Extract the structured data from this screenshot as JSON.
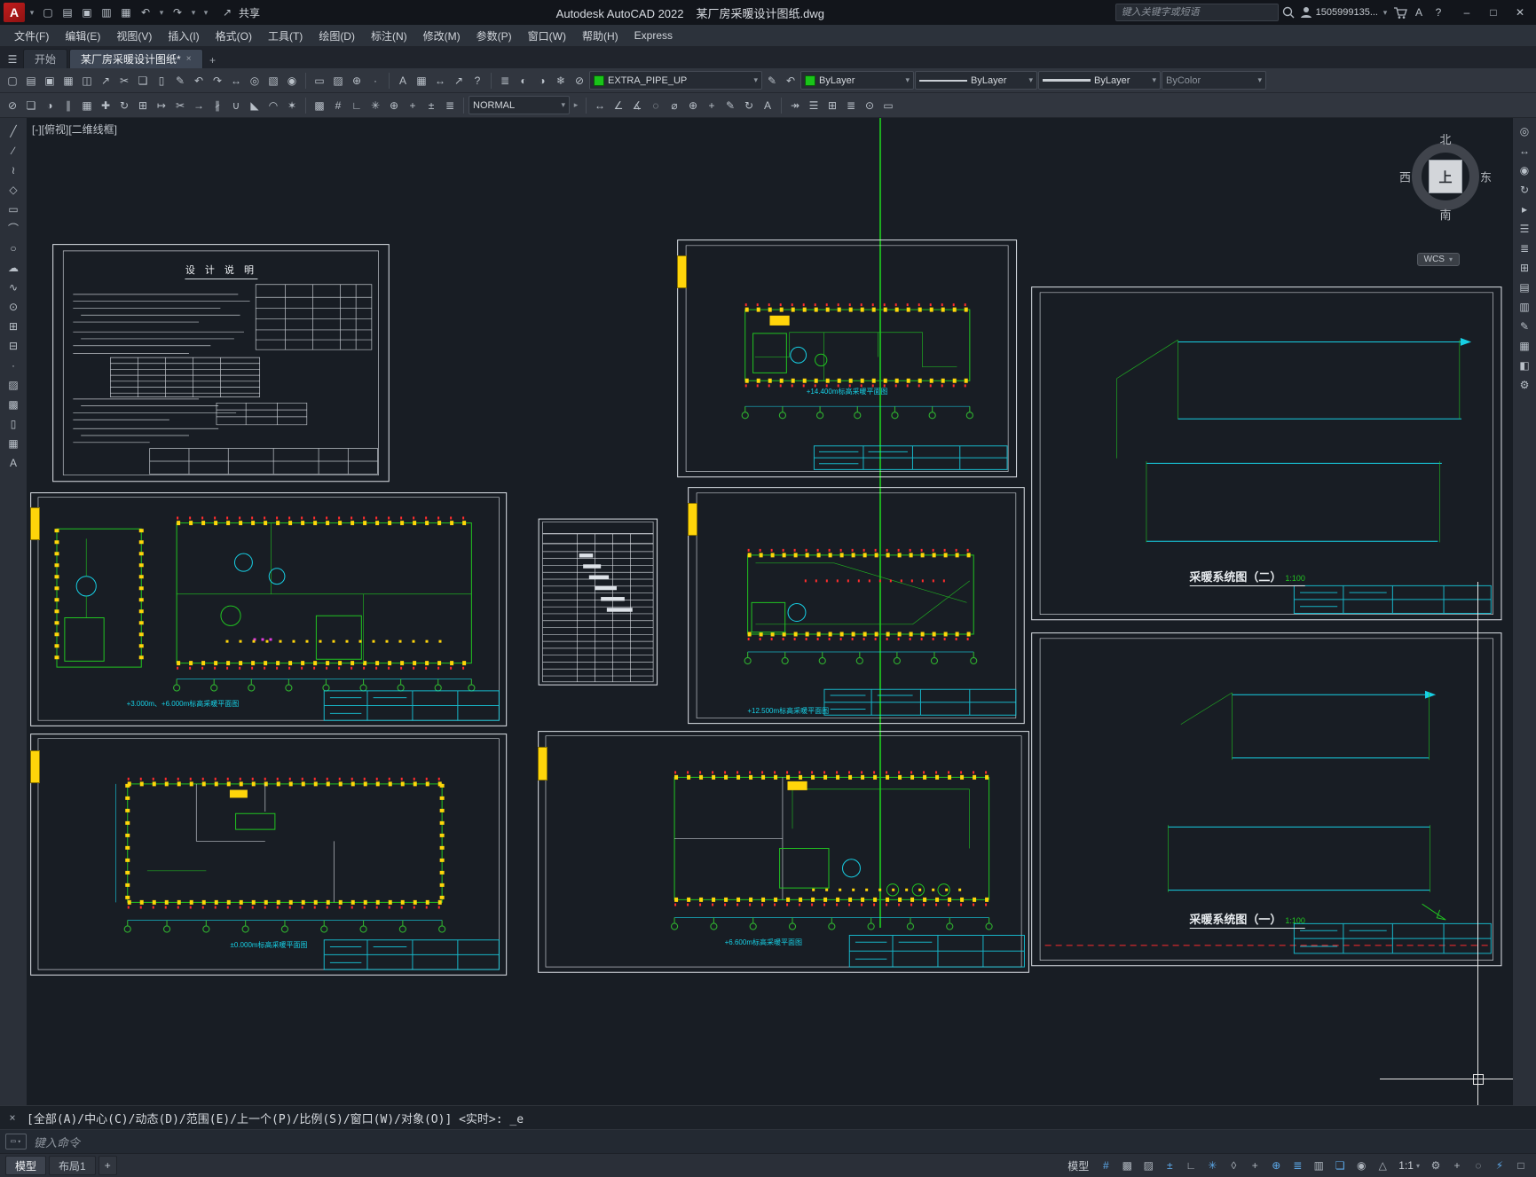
{
  "titlebar": {
    "app_title": "Autodesk AutoCAD 2022",
    "doc_title": "某厂房采暖设计图纸.dwg",
    "share_label": "共享",
    "search_placeholder": "键入关键字或短语",
    "account_id": "1505999135..."
  },
  "menubar": {
    "items": [
      {
        "label": "文件(F)"
      },
      {
        "label": "编辑(E)"
      },
      {
        "label": "视图(V)"
      },
      {
        "label": "插入(I)"
      },
      {
        "label": "格式(O)"
      },
      {
        "label": "工具(T)"
      },
      {
        "label": "绘图(D)"
      },
      {
        "label": "标注(N)"
      },
      {
        "label": "修改(M)"
      },
      {
        "label": "参数(P)"
      },
      {
        "label": "窗口(W)"
      },
      {
        "label": "帮助(H)"
      },
      {
        "label": "Express"
      }
    ]
  },
  "filetabs": {
    "start": "开始",
    "document": "某厂房采暖设计图纸*",
    "close": "×",
    "new_tab": "+"
  },
  "toolbars": {
    "layer": "EXTRA_PIPE_UP",
    "color": "ByLayer",
    "linetype": "ByLayer",
    "lineweight": "ByLayer",
    "plot_style": "ByColor",
    "text_style": "NORMAL"
  },
  "viewport": {
    "controls_label": "[-][俯视][二维线框]",
    "wcs_label": "WCS",
    "compass": {
      "north": "北",
      "south": "南",
      "west": "西",
      "east": "东",
      "up": "上"
    }
  },
  "sheets": {
    "design_notes": {
      "title": "设 计 说 明"
    },
    "plans": [
      {
        "label": "+14.400m标高采暖平面图"
      },
      {
        "label": "+3.000m、+6.000m标高采暖平面图"
      },
      {
        "label": "+12.500m标高采暖平面图"
      },
      {
        "label": "±0.000m标高采暖平面图"
      },
      {
        "label": "+6.600m标高采暖平面图"
      }
    ],
    "system_two": {
      "label": "采暖系统图（二）",
      "scale": "1:100"
    },
    "system_one": {
      "label": "采暖系统图（一）",
      "scale": "1:100"
    }
  },
  "command": {
    "history": "[全部(A)/中心(C)/动态(D)/范围(E)/上一个(P)/比例(S)/窗口(W)/对象(O)] <实时>: _e",
    "placeholder": "键入命令"
  },
  "statusbar": {
    "model_tab": "模型",
    "layout_tab": "布局1",
    "new_layout": "+",
    "model_label": "模型",
    "scale": "1:1"
  },
  "icons": {
    "burger": "☰",
    "new": "▢",
    "open": "▤",
    "save": "▣",
    "saveas": "▥",
    "plot": "▦",
    "preview": "◫",
    "publish": "↗",
    "cut": "✂",
    "copy": "❏",
    "paste": "▯",
    "match": "✎",
    "undo": "↶",
    "redo": "↷",
    "pan": "↔",
    "zoomr": "◎",
    "zoomw": "▧",
    "zoome": "◉",
    "dropdown": "▾",
    "share": "↗",
    "min": "–",
    "max": "□",
    "close": "✕",
    "apps": "A",
    "help": "?",
    "field": "▭",
    "raster": "▨",
    "osnapset": "⊕",
    "pointstyle": "·",
    "text": "A",
    "table": "▦",
    "dim": "↔",
    "leader": "↗",
    "layers": "≣",
    "layeroff": "◐",
    "layeriso": "◑",
    "layerfrz": "❄",
    "layerlock": "⊘",
    "layermatch": "✎",
    "layerprev": "↶",
    "erase": "⊘",
    "mirror": "◑",
    "offset": "∥",
    "array": "▦",
    "move": "✚",
    "rotate": "↻",
    "scale": "⊞",
    "stretch": "↦",
    "trim": "✂",
    "extend": "→",
    "break": "∦",
    "join": "∪",
    "chamfer": "◣",
    "fillet": "◠",
    "explode": "✶",
    "grid": "#",
    "snap": "▩",
    "infer": "▨",
    "dyn": "±",
    "ortho": "∟",
    "polar": "✳",
    "otrack": "+",
    "qprop": "▢",
    "dimlin": "↔",
    "dimali": "∠",
    "dimang": "∡",
    "dimrad": "◌",
    "dimdia": "⌀",
    "tol": "⊕",
    "cmark": "+",
    "dimedit": "✎",
    "dimupd": "↻",
    "style": "A",
    "dist": "↠",
    "props": "☰",
    "calc": "⊞",
    "list": "≣",
    "idpt": "⊙",
    "area": "▭",
    "line": "╱",
    "xlineic": "∕",
    "pline": "≀",
    "polygon": "◇",
    "rect": "▭",
    "arc": "⌒",
    "circle": "○",
    "revcloud": "☁",
    "spline": "∿",
    "ellipse": "⊙",
    "insblock": "⊞",
    "mkblock": "⊟",
    "point": "·",
    "hatch": "▨",
    "gradient": "▩",
    "region": "▯",
    "mtext": "A",
    "wheel": "◎",
    "orbit": "↻",
    "motion": "▸",
    "palettes": "▤",
    "sheetset": "▥",
    "markup": "✎",
    "render": "▦",
    "materials": "◧",
    "gear": "⚙",
    "iso": "◊",
    "transp": "▥",
    "cycling": "❏",
    "annovis": "◉",
    "autoscale": "△",
    "annomon": "+",
    "isolate": "◌",
    "graphics": "⚡",
    "clean": "□",
    "chev": "▸"
  }
}
